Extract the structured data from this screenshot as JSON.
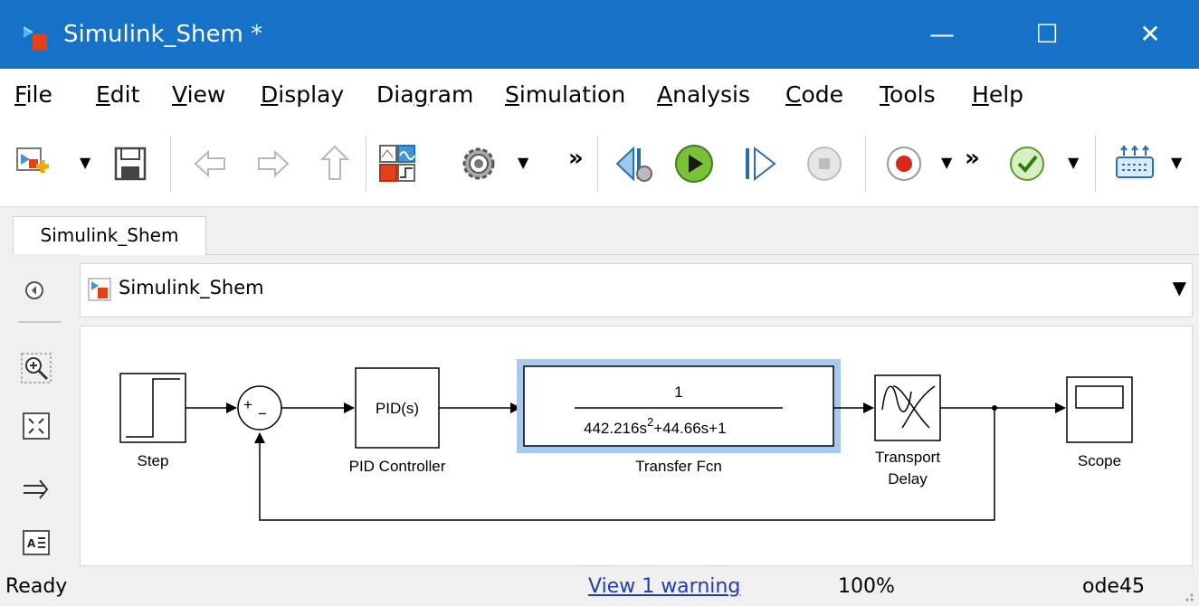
{
  "window": {
    "title": "Simulink_Shem *",
    "minimize": "—",
    "maximize": "☐",
    "close": "✕"
  },
  "menu": [
    "File",
    "Edit",
    "View",
    "Display",
    "Diagram",
    "Simulation",
    "Analysis",
    "Code",
    "Tools",
    "Help"
  ],
  "menu_underline": [
    "F",
    "E",
    "V",
    "D",
    "g",
    "S",
    "A",
    "C",
    "T",
    "H"
  ],
  "tab": {
    "label": "Simulink_Shem"
  },
  "address": {
    "path": "Simulink_Shem"
  },
  "toolbar": {
    "more1": "»",
    "more2": "»"
  },
  "blocks": {
    "step": "Step",
    "sum_sign": "+",
    "sum_minus": "−",
    "pid_inner": "PID(s)",
    "pid_label": "PID Controller",
    "tf_num": "1",
    "tf_den_a": "442.216s",
    "tf_den_exp": "2",
    "tf_den_b": "+44.66s+1",
    "tf_label": "Transfer Fcn",
    "delay_label_1": "Transport",
    "delay_label_2": "Delay",
    "scope_label": "Scope"
  },
  "status": {
    "ready": "Ready",
    "warning": "View 1 warning",
    "zoom": "100%",
    "solver": "ode45"
  },
  "colors": {
    "titlebar": "#1572c6",
    "selection": "#a9c8ef",
    "link": "#1f3fb0"
  }
}
